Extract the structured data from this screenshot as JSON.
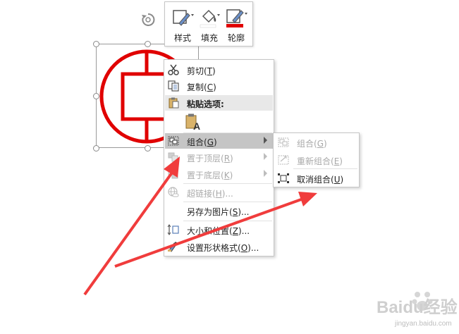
{
  "mini_toolbar": {
    "style_label": "样式",
    "fill_label": "填充",
    "outline_label": "轮廓",
    "outline_color": "#e00000"
  },
  "context_menu": {
    "cut": {
      "label": "剪切",
      "key": "T"
    },
    "copy": {
      "label": "复制",
      "key": "C"
    },
    "paste_options_label": "粘贴选项:",
    "group": {
      "label": "组合",
      "key": "G"
    },
    "bring_to_front": {
      "label": "置于顶层",
      "key": "R"
    },
    "send_to_back": {
      "label": "置于底层",
      "key": "K"
    },
    "hyperlink": {
      "label": "超链接",
      "key": "H",
      "suffix": "..."
    },
    "save_as_picture": {
      "label": "另存为图片",
      "key": "S",
      "suffix": "..."
    },
    "size_position": {
      "label": "大小和位置",
      "key": "Z",
      "suffix": "..."
    },
    "format_shape": {
      "label": "设置形状格式",
      "key": "O",
      "suffix": "..."
    }
  },
  "submenu": {
    "group": {
      "label": "组合",
      "key": "G"
    },
    "regroup": {
      "label": "重新组合",
      "key": "E"
    },
    "ungroup": {
      "label": "取消组合",
      "key": "U"
    }
  },
  "colors": {
    "shape_red": "#e00000",
    "arrow_red": "#f03c3c",
    "menu_hover": "#c5c5c5"
  },
  "watermark": {
    "main": "Baidu经验",
    "sub": "jingyan.baidu.com"
  }
}
